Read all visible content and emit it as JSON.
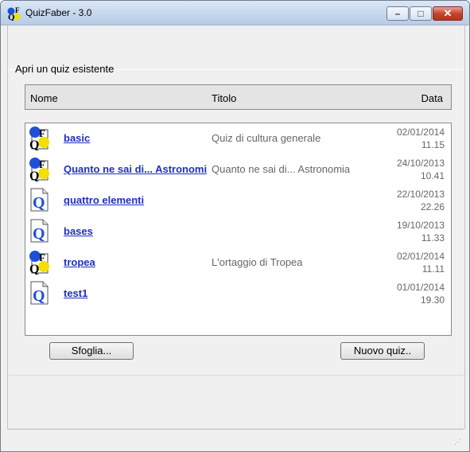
{
  "window": {
    "title": "QuizFaber - 3.0"
  },
  "section": {
    "label": "Apri un quiz esistente"
  },
  "columns": {
    "name": "Nome",
    "title": "Titolo",
    "date": "Data"
  },
  "rows": [
    {
      "icon": "quizfaber-logo-icon",
      "name": "basic",
      "title": "Quiz di cultura generale",
      "date": "02/01/2014",
      "time": "11.15"
    },
    {
      "icon": "quizfaber-logo-icon",
      "name": "Quanto ne sai di... Astronomi",
      "title": "Quanto ne sai di... Astronomia",
      "date": "24/10/2013",
      "time": "10.41"
    },
    {
      "icon": "quiz-document-icon",
      "name": "quattro elementi",
      "title": "",
      "date": "22/10/2013",
      "time": "22.26"
    },
    {
      "icon": "quiz-document-icon",
      "name": "bases",
      "title": "",
      "date": "19/10/2013",
      "time": "11.33"
    },
    {
      "icon": "quizfaber-logo-icon",
      "name": "tropea",
      "title": "L'ortaggio di Tropea",
      "date": "02/01/2014",
      "time": "11.11"
    },
    {
      "icon": "quiz-document-icon",
      "name": "test1",
      "title": "",
      "date": "01/01/2014",
      "time": "19.30"
    }
  ],
  "buttons": {
    "browse": "Sfoglia...",
    "new_quiz": "Nuovo quiz.."
  },
  "controls": {
    "minimize": "–",
    "maximize": "□",
    "close": "✕"
  },
  "colors": {
    "link": "#1f2fbf",
    "title_bar": "#c6d7ec",
    "close_button": "#c7442c"
  }
}
